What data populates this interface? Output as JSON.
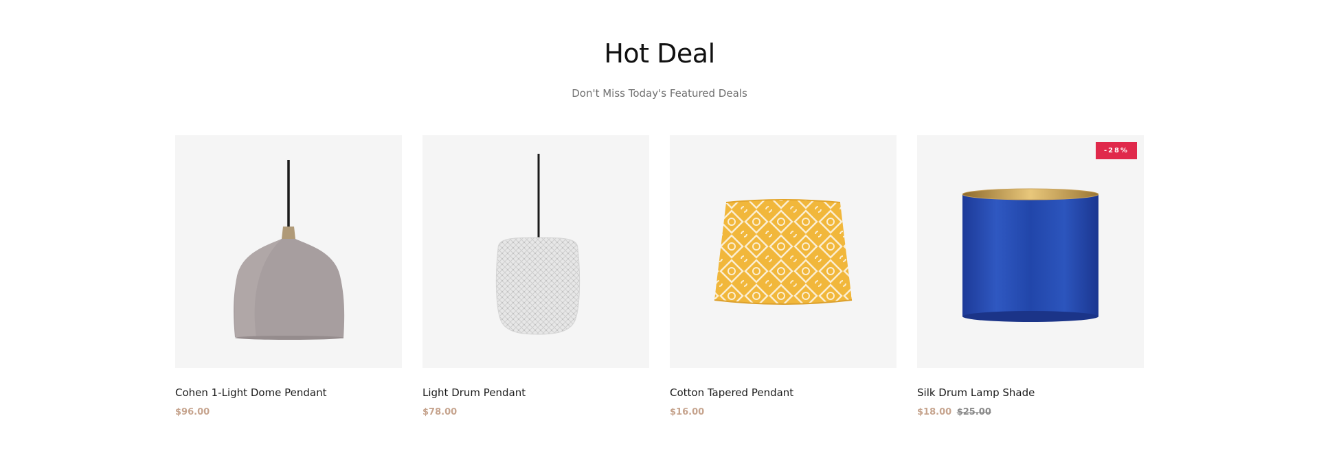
{
  "section": {
    "title": "Hot Deal",
    "subtitle": "Don't Miss Today's Featured Deals"
  },
  "products": [
    {
      "name": "Cohen 1-Light Dome Pendant",
      "price": "$96.00",
      "image_icon": "dome-pendant-lamp-icon"
    },
    {
      "name": "Light Drum Pendant",
      "price": "$78.00",
      "image_icon": "drum-pendant-lamp-icon"
    },
    {
      "name": "Cotton Tapered Pendant",
      "price": "$16.00",
      "image_icon": "tapered-lamp-shade-icon"
    },
    {
      "name": "Silk Drum Lamp Shade",
      "price": "$18.00",
      "old_price": "$25.00",
      "badge": "-28%",
      "image_icon": "drum-lamp-shade-icon"
    }
  ],
  "colors": {
    "price": "#c6a48e",
    "badge": "#e0294b",
    "image_bg": "#f5f5f5"
  }
}
